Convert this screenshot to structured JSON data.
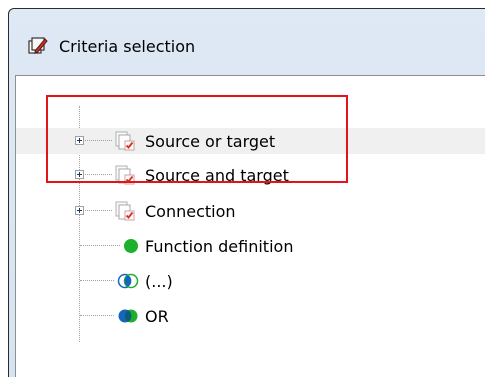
{
  "window": {
    "title": "Criteria selection",
    "title_icon": "criteria-pen-icon"
  },
  "tree": {
    "items": [
      {
        "label": "Source or target",
        "icon": "document-check-icon",
        "expandable": true,
        "selected": true
      },
      {
        "label": "Source and target",
        "icon": "document-check-icon",
        "expandable": true,
        "selected": false
      },
      {
        "label": "Connection",
        "icon": "document-check-icon",
        "expandable": true,
        "selected": false
      },
      {
        "label": "Function definition",
        "icon": "green-dot-icon",
        "expandable": false,
        "selected": false
      },
      {
        "label": "(...)",
        "icon": "half-circles-icon",
        "expandable": false,
        "selected": false
      },
      {
        "label": "OR",
        "icon": "blue-green-circles-icon",
        "expandable": false,
        "selected": false
      }
    ]
  },
  "colors": {
    "highlight_border": "#e1141c",
    "green": "#1db02b",
    "blue": "#1565c0",
    "check_red": "#e0322c"
  }
}
